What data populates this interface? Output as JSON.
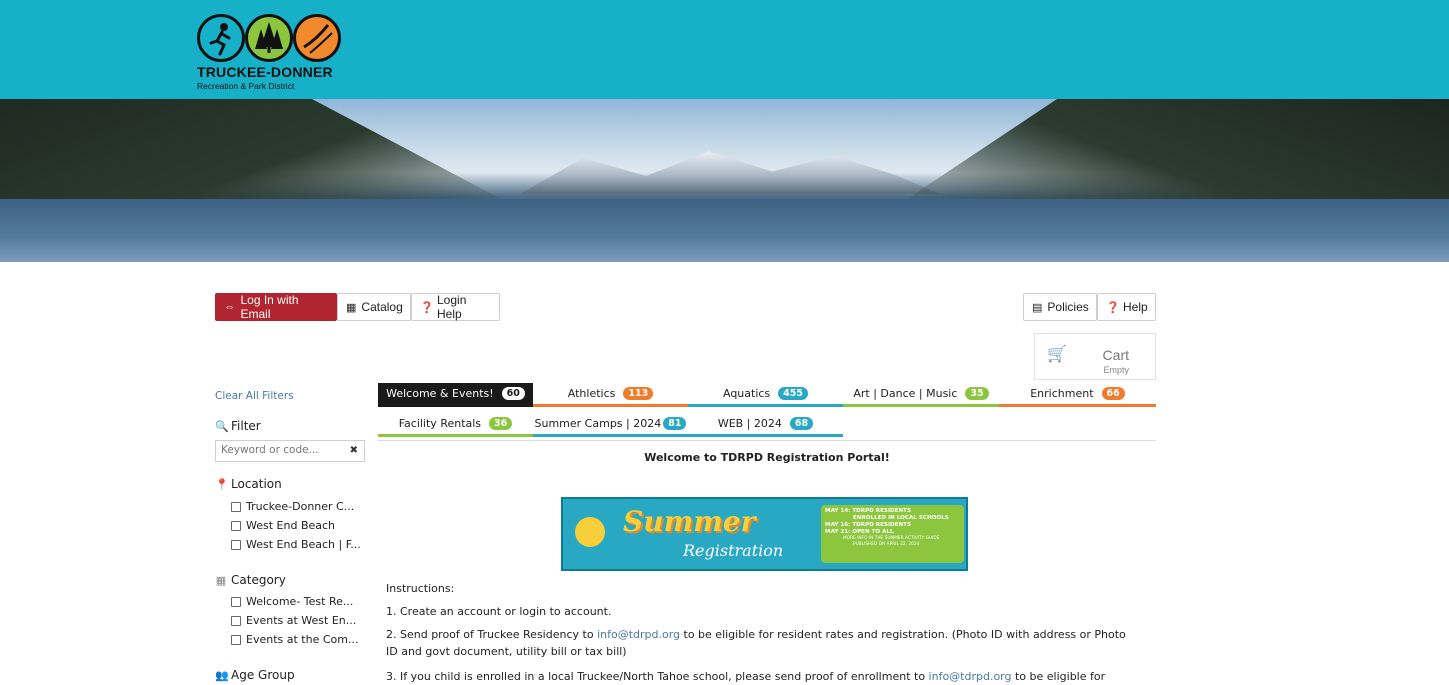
{
  "header": {
    "brand": "TRUCKEE-DONNER",
    "subtitle": "Recreation & Park District"
  },
  "toolbar": {
    "login_label": "Log In with Email",
    "catalog_label": "Catalog",
    "login_help_label": "Login Help",
    "policies_label": "Policies",
    "help_label": "Help"
  },
  "cart": {
    "label": "Cart",
    "status": "Empty"
  },
  "sidebar": {
    "clear_filters": "Clear All Filters",
    "filter_heading": "Filter",
    "filter_placeholder": "Keyword or code...",
    "location_heading": "Location",
    "locations": [
      "Truckee-Donner C...",
      "West End Beach",
      "West End Beach | F..."
    ],
    "category_heading": "Category",
    "categories": [
      "Welcome- Test Re...",
      "Events at West En...",
      "Events at the Com..."
    ],
    "age_heading": "Age Group"
  },
  "tabs": [
    {
      "label": "Welcome & Events!",
      "count": "60",
      "color": "#1a1a1a"
    },
    {
      "label": "Athletics",
      "count": "113",
      "color": "#f07c2b"
    },
    {
      "label": "Aquatics",
      "count": "455",
      "color": "#29a8c4"
    },
    {
      "label": "Art | Dance | Music",
      "count": "35",
      "color": "#8cc63f"
    },
    {
      "label": "Enrichment",
      "count": "66",
      "color": "#f07c2b"
    },
    {
      "label": "Facility Rentals",
      "count": "36",
      "color": "#8cc63f"
    },
    {
      "label": "Summer Camps | 2024",
      "count": "81",
      "color": "#29a8c4"
    },
    {
      "label": "WEB | 2024",
      "count": "68",
      "color": "#29a8c4"
    }
  ],
  "content": {
    "welcome": "Welcome to TDRPD Registration Portal!",
    "promo": {
      "word1": "Summer",
      "word2": "Registration",
      "lines": [
        "MAY 14: TDRPD RESIDENTS",
        "ENROLLED IN LOCAL SCHOOLS",
        "MAY 16: TDRPD RESIDENTS",
        "MAY 21: OPEN TO ALL"
      ],
      "fine": [
        "MORE INFO IN THE SUMMER ACTIVITY GUIDE",
        "PUBLISHED ON APRIL 22, 2024"
      ]
    },
    "instructions_heading": "Instructions:",
    "step1": "1. Create an account or login to account.",
    "step2_pre": "2. Send proof of Truckee Residency to ",
    "email": "info@tdrpd.org",
    "step2_post": " to be eligible for resident rates and registration. (Photo ID with address or Photo",
    "step2_line2": "ID and govt document, utility bill or tax bill)",
    "step3_pre": "3. If you child is enrolled in a local Truckee/North Tahoe school, please send proof of enrollment to ",
    "step3_post": " to be eligible for"
  }
}
